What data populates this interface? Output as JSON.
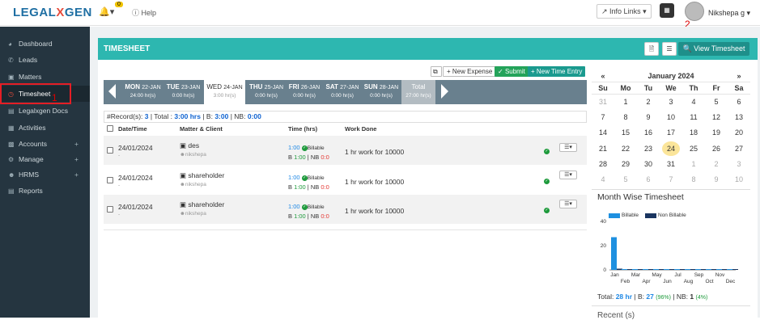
{
  "header": {
    "logo_left": "LEGAL",
    "logo_x": "X",
    "logo_right": "GEN",
    "notification_count": "0",
    "help_label": "Help",
    "info_links_label": "Info Links",
    "user_name": "Nikshepa g"
  },
  "annotations": {
    "marker1": "1",
    "marker2": "2"
  },
  "sidebar": {
    "items": [
      {
        "label": "Dashboard"
      },
      {
        "label": "Leads"
      },
      {
        "label": "Matters"
      },
      {
        "label": "Timesheet"
      },
      {
        "label": "Legalxgen Docs"
      },
      {
        "label": "Activities"
      },
      {
        "label": "Accounts"
      },
      {
        "label": "Manage"
      },
      {
        "label": "HRMS"
      },
      {
        "label": "Reports"
      }
    ]
  },
  "panel": {
    "title": "TIMESHEET",
    "view_timesheet_label": "View Timesheet",
    "new_expense_label": "New Expense",
    "submit_label": "Submit",
    "new_time_entry_label": "New Time Entry"
  },
  "week": {
    "days": [
      {
        "name": "MON",
        "date": "22-JAN",
        "hours": "24:00 hr(s)"
      },
      {
        "name": "TUE",
        "date": "23-JAN",
        "hours": "0:00 hr(s)"
      },
      {
        "name": "WED",
        "date": "24-JAN",
        "hours": "3:00 hr(s)"
      },
      {
        "name": "THU",
        "date": "25-JAN",
        "hours": "0:00 hr(s)"
      },
      {
        "name": "FRI",
        "date": "26-JAN",
        "hours": "0:00 hr(s)"
      },
      {
        "name": "SAT",
        "date": "27-JAN",
        "hours": "0:00 hr(s)"
      },
      {
        "name": "SUN",
        "date": "28-JAN",
        "hours": "0:00 hr(s)"
      }
    ],
    "total_label": "Total",
    "total_hours": "27:00 hr(s)"
  },
  "summary": {
    "records_label": "#Record(s):",
    "records": "3",
    "total_label": "| Total :",
    "total": "3:00 hrs",
    "b_label": "| B:",
    "b": "3:00",
    "nb_label": "| NB:",
    "nb": "0:00"
  },
  "table": {
    "columns": [
      "Date/Time",
      "Matter & Client",
      "Time (hrs)",
      "Work Done"
    ],
    "rows": [
      {
        "date": "24/01/2024",
        "date_sub": "-",
        "matter": "des",
        "client": "nikshepa",
        "time": "1:00",
        "billable_label": "Billable",
        "b_label": "B",
        "b": "1:00",
        "nb_label": "NB",
        "nb": "0:0",
        "work": "1 hr work for 10000"
      },
      {
        "date": "24/01/2024",
        "date_sub": "-",
        "matter": "shareholder",
        "client": "nikshepa",
        "time": "1:00",
        "billable_label": "Billable",
        "b_label": "B",
        "b": "1:00",
        "nb_label": "NB",
        "nb": "0:0",
        "work": "1 hr work for 10000"
      },
      {
        "date": "24/01/2024",
        "date_sub": "-",
        "matter": "shareholder",
        "client": "nikshepa",
        "time": "1:00",
        "billable_label": "Billable",
        "b_label": "B",
        "b": "1:00",
        "nb_label": "NB",
        "nb": "0:0",
        "work": "1 hr work for 10000"
      }
    ]
  },
  "calendar": {
    "prev": "«",
    "next": "»",
    "month_label": "January 2024",
    "weekday_headers": [
      "Su",
      "Mo",
      "Tu",
      "We",
      "Th",
      "Fr",
      "Sa"
    ],
    "weeks": [
      [
        "31",
        "1",
        "2",
        "3",
        "4",
        "5",
        "6"
      ],
      [
        "7",
        "8",
        "9",
        "10",
        "11",
        "12",
        "13"
      ],
      [
        "14",
        "15",
        "16",
        "17",
        "18",
        "19",
        "20"
      ],
      [
        "21",
        "22",
        "23",
        "24",
        "25",
        "26",
        "27"
      ],
      [
        "28",
        "29",
        "30",
        "31",
        "1",
        "2",
        "3"
      ],
      [
        "4",
        "5",
        "6",
        "7",
        "8",
        "9",
        "10"
      ]
    ],
    "today": "24"
  },
  "month_wise": {
    "title": "Month Wise Timesheet",
    "legend_billable": "Billable",
    "legend_non_billable": "Non Billable",
    "colors": {
      "billable": "#1e90e0",
      "non_billable": "#1a3560"
    },
    "totals": {
      "total_label": "Total:",
      "total": "28 hr",
      "b_label": "| B:",
      "b": "27",
      "b_pct": "(96%)",
      "nb_label": "| NB:",
      "nb": "1",
      "nb_pct": "(4%)"
    }
  },
  "chart_data": {
    "type": "bar",
    "categories": [
      "Jan",
      "Feb",
      "Mar",
      "Apr",
      "May",
      "Jun",
      "Jul",
      "Aug",
      "Sep",
      "Oct",
      "Nov",
      "Dec"
    ],
    "series": [
      {
        "name": "Billable",
        "values": [
          27,
          0,
          0,
          0,
          0,
          0,
          0,
          0,
          0,
          0,
          0,
          0
        ]
      },
      {
        "name": "Non Billable",
        "values": [
          1,
          0,
          0,
          0,
          0,
          0,
          0,
          0,
          0,
          0,
          0,
          0
        ]
      }
    ],
    "y_ticks": [
      "40",
      "20",
      "0"
    ],
    "ylim": [
      0,
      40
    ],
    "legend": "top-left"
  },
  "recent": {
    "title": "Recent (s)"
  }
}
